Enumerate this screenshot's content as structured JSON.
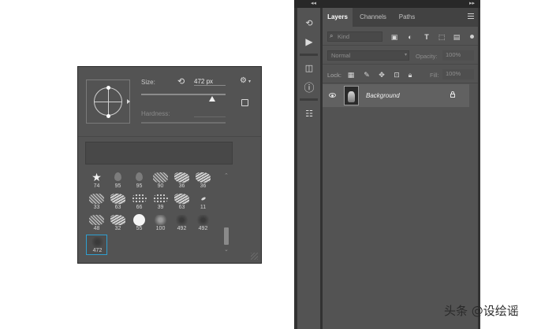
{
  "brush_picker": {
    "size_label": "Size:",
    "size_value": "472 px",
    "hardness_label": "Hardness:",
    "size_slider_fraction": 0.84,
    "brushes": [
      {
        "num": "74",
        "kind": "star"
      },
      {
        "num": "95",
        "kind": "drop"
      },
      {
        "num": "95",
        "kind": "drop"
      },
      {
        "num": "90",
        "kind": "tex"
      },
      {
        "num": "36",
        "kind": "tex2"
      },
      {
        "num": "36",
        "kind": "tex2"
      },
      {
        "num": "33",
        "kind": "tex"
      },
      {
        "num": "63",
        "kind": "tex2"
      },
      {
        "num": "66",
        "kind": "dots"
      },
      {
        "num": "39",
        "kind": "dots"
      },
      {
        "num": "63",
        "kind": "tex2"
      },
      {
        "num": "11",
        "kind": "leaf"
      },
      {
        "num": "48",
        "kind": "tex"
      },
      {
        "num": "32",
        "kind": "tex2"
      },
      {
        "num": "55",
        "kind": "round"
      },
      {
        "num": "100",
        "kind": "soft"
      },
      {
        "num": "492",
        "kind": "dark"
      },
      {
        "num": "492",
        "kind": "dark"
      },
      {
        "num": "472",
        "kind": "dark",
        "selected": true
      }
    ]
  },
  "panel": {
    "tabs": [
      "Layers",
      "Channels",
      "Paths"
    ],
    "active_tab": "Layers",
    "kind_placeholder": "Kind",
    "blend_mode": "Normal",
    "opacity_label": "Opacity:",
    "opacity_value": "100%",
    "lock_label": "Lock:",
    "fill_label": "Fill:",
    "fill_value": "100%",
    "layers": [
      {
        "name": "Background",
        "visible": true,
        "locked": true
      }
    ]
  },
  "watermark": "头条 @设绘谣"
}
